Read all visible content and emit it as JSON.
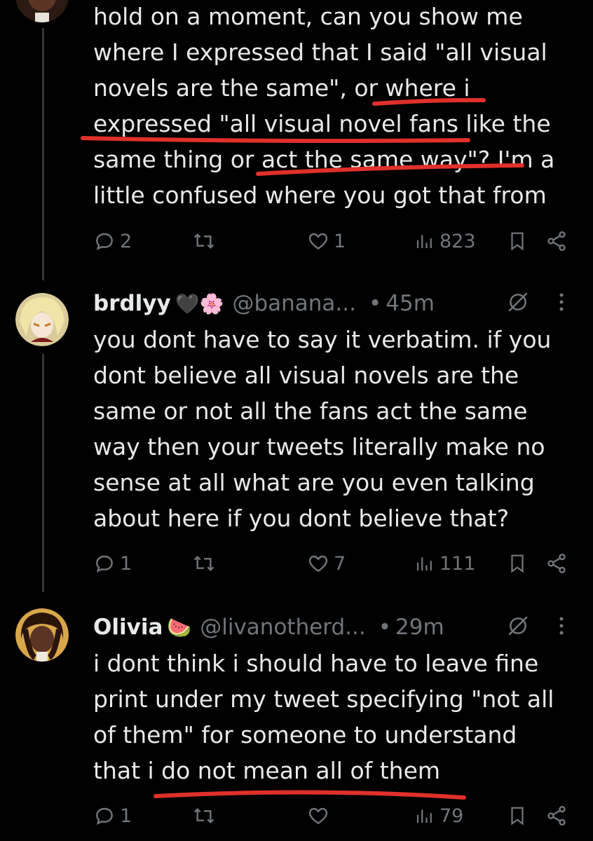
{
  "tweets": [
    {
      "text": "hold on a moment, can you show me\nwhere I expressed that I said \"all visual\nnovels are the same\", or where i\nexpressed \"all visual novel fans like the\nsame thing or act the same way\"? I'm a\nlittle confused where you got that from",
      "replies": "2",
      "retweets": "",
      "likes": "1",
      "views": "823"
    },
    {
      "name": "brdlyy",
      "name_emoji": "🖤🌸",
      "handle": "@banana...",
      "dot": "•",
      "time": "45m",
      "text": "you dont have to say it verbatim. if you\ndont believe all visual novels are the\nsame or not all the fans act the same\nway then your tweets literally make no\nsense at all what are you even talking\nabout here if you dont believe that?",
      "replies": "1",
      "retweets": "",
      "likes": "7",
      "views": "111"
    },
    {
      "name": "Olivia",
      "name_emoji": "🍉",
      "handle": "@livanotherd...",
      "dot": "•",
      "time": "29m",
      "text": "i dont think i should have to leave fine\nprint under my tweet specifying \"not all\nof them\" for someone to understand\nthat i do not mean all of them",
      "replies": "1",
      "retweets": "",
      "likes": "",
      "views": "79"
    }
  ],
  "colors": {
    "background": "#000000",
    "text": "#e7e9ea",
    "muted": "#71767b",
    "annotation": "#e0302a"
  },
  "icons": [
    "reply-icon",
    "retweet-icon",
    "like-icon",
    "views-icon",
    "bookmark-icon",
    "share-icon",
    "grok-icon",
    "more-icon"
  ]
}
